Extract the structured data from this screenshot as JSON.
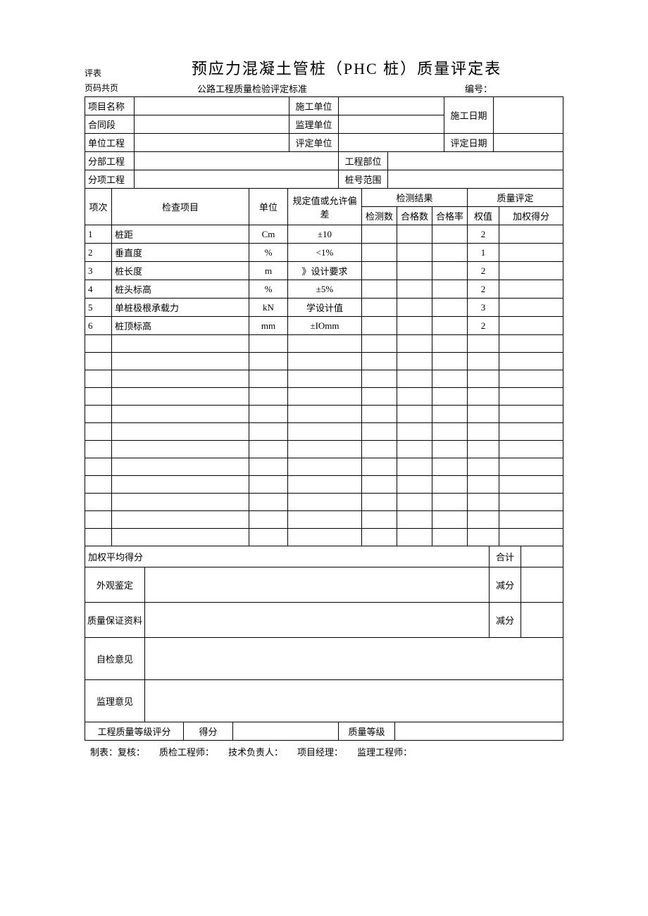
{
  "header": {
    "small_left": "评表",
    "title": "预应力混凝土管桩（PHC 桩）质量评定表",
    "page_label": "页码共页",
    "standard": "公路工程质量检验评定标准",
    "bh_label": "编号："
  },
  "info": {
    "r1c1": "项目名称",
    "r1c3": "施工单位",
    "r1c5": "施工日期",
    "r2c1": "合同段",
    "r2c3": "监理单位",
    "r3c1": "单位工程",
    "r3c3": "评定单位",
    "r3c5": "评定日期",
    "r4c1": "分部工程",
    "r4c3": "工程部位",
    "r5c1": "分项工程",
    "r5c3": "桩号范围"
  },
  "thead": {
    "col1": "项次",
    "col2": "检查项目",
    "col3": "单位",
    "col4": "规定值或允许偏差",
    "group_test": "检测结果",
    "test_a": "检测数",
    "test_b": "合格数",
    "test_c": "合格率",
    "group_quality": "质量评定",
    "q_a": "权值",
    "q_b": "加权得分"
  },
  "rows": [
    {
      "no": "1",
      "item": "桩距",
      "unit": "Cm",
      "spec": "±10",
      "weight": "2"
    },
    {
      "no": "2",
      "item": "垂直度",
      "unit": "%",
      "spec": "<1%",
      "weight": "1"
    },
    {
      "no": "3",
      "item": "桩长度",
      "unit": "m",
      "spec": "》设计要求",
      "weight": "2"
    },
    {
      "no": "4",
      "item": "桩头标高",
      "unit": "%",
      "spec": "±5%",
      "weight": "2"
    },
    {
      "no": "5",
      "item": "单桩极根承载力",
      "unit": "kN",
      "spec": "学设计值",
      "weight": "3"
    },
    {
      "no": "6",
      "item": "桩顶标高",
      "unit": "mm",
      "spec": "±IOmm",
      "weight": "2"
    }
  ],
  "empty_row_count": 12,
  "bottom": {
    "weighted_avg": "加权平均得分",
    "total": "合计",
    "appearance": "外观鉴定",
    "deduct": "减分",
    "qa_docs": "质量保证资料",
    "self_check": "自检意见",
    "supervise": "监理意见",
    "grade_label": "工程质量等级评分",
    "score_label": "得分",
    "quality_grade": "质量等级"
  },
  "footer": {
    "a": "制表：复核：",
    "b": "质检工程师：",
    "c": "技术负责人：",
    "d": "项目经理：",
    "e": "监理工程师："
  }
}
